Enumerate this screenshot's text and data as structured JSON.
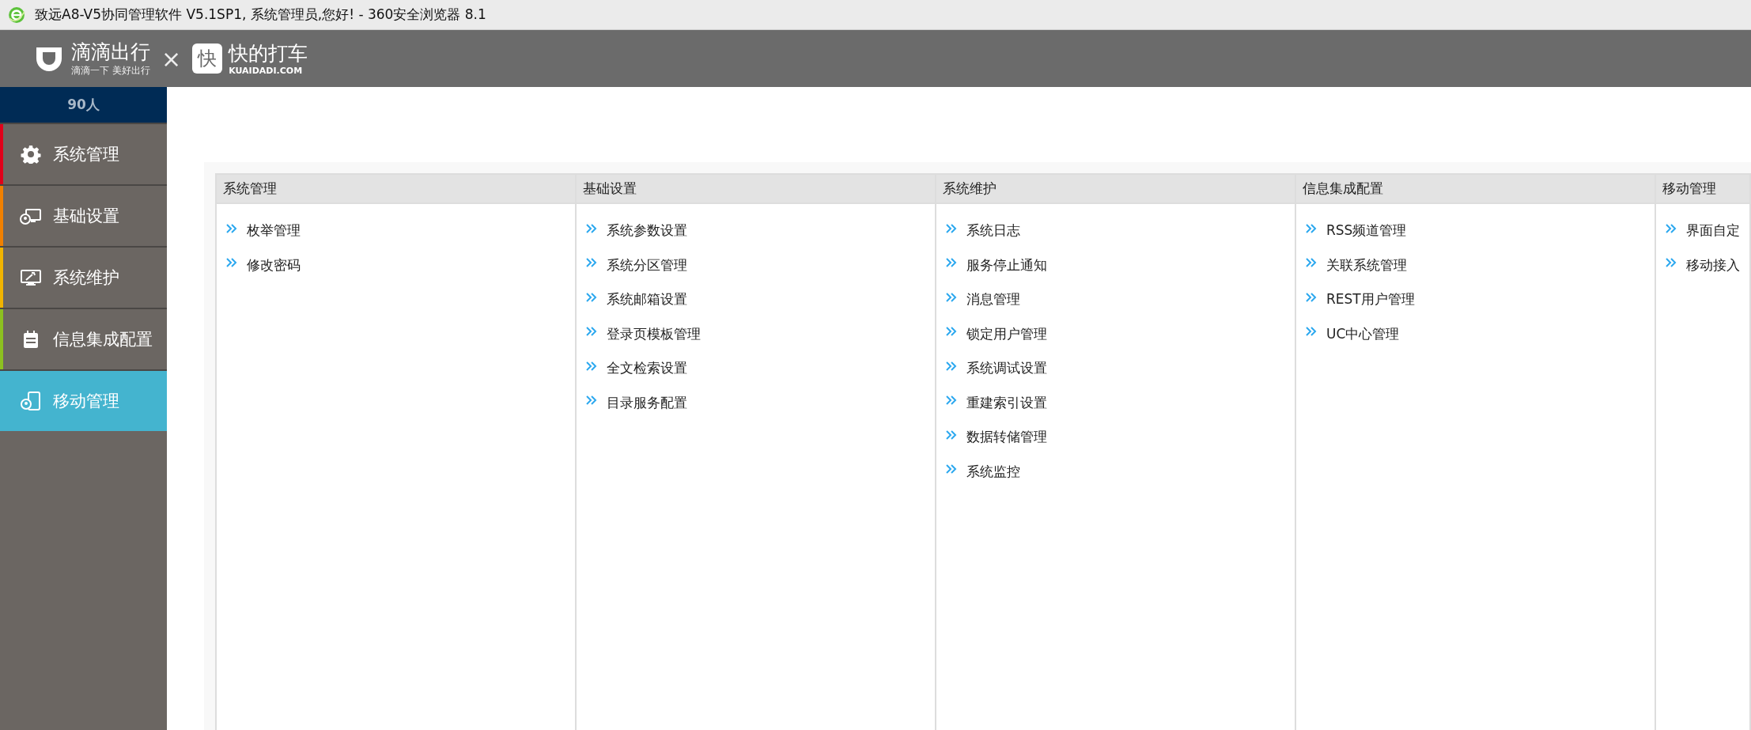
{
  "window": {
    "title": "致远A8-V5协同管理软件 V5.1SP1, 系统管理员,您好! - 360安全浏览器 8.1"
  },
  "header": {
    "logo_left": {
      "name": "滴滴出行",
      "slogan": "滴滴一下 美好出行"
    },
    "separator": "×",
    "logo_right": {
      "mark": "快",
      "name": "快的打车",
      "domain": "KUAIDADI.COM"
    }
  },
  "sidebar": {
    "count": "90人",
    "items": [
      {
        "label": "系统管理",
        "color": "#e0001a",
        "selected": false
      },
      {
        "label": "基础设置",
        "color": "#f08000",
        "selected": false
      },
      {
        "label": "系统维护",
        "color": "#f0b400",
        "selected": false
      },
      {
        "label": "信息集成配置",
        "color": "#8cc020",
        "selected": false
      },
      {
        "label": "移动管理",
        "selected": true
      }
    ]
  },
  "columns": [
    {
      "heading": "系统管理",
      "items": [
        "枚举管理",
        "修改密码"
      ]
    },
    {
      "heading": "基础设置",
      "items": [
        "系统参数设置",
        "系统分区管理",
        "系统邮箱设置",
        "登录页模板管理",
        "全文检索设置",
        "目录服务配置"
      ]
    },
    {
      "heading": "系统维护",
      "items": [
        "系统日志",
        "服务停止通知",
        "消息管理",
        "锁定用户管理",
        "系统调试设置",
        "重建索引设置",
        "数据转储管理",
        "系统监控"
      ]
    },
    {
      "heading": "信息集成配置",
      "items": [
        "RSS频道管理",
        "关联系统管理",
        "REST用户管理",
        "UC中心管理"
      ]
    },
    {
      "heading": "移动管理",
      "items": [
        "界面自定",
        "移动接入"
      ]
    }
  ]
}
